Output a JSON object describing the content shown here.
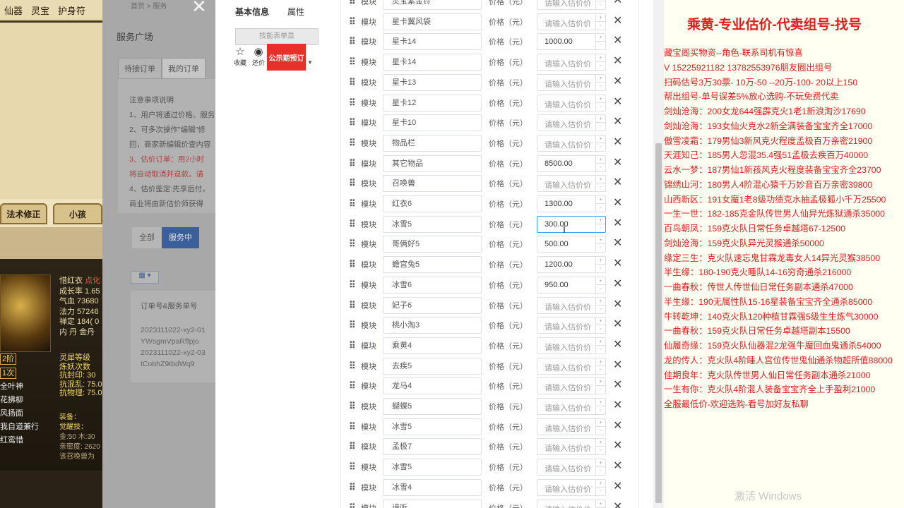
{
  "game": {
    "menu": [
      "仙器",
      "灵宝",
      "护身符"
    ],
    "tabs": [
      "法术修正",
      "小孩"
    ],
    "char_name": "惜红衣",
    "char_name_tag": "点化",
    "stats": [
      "成长率 1.65",
      "气血 73680",
      "法力 57246",
      "禅定 184( 0",
      "内 丹 金丹"
    ],
    "stats2": [
      "灵犀等级",
      "炼妖次数",
      "抗封印: 30",
      "抗混乱: 75.0",
      "抗物理: 75.0"
    ],
    "side": [
      "2阶",
      "1次",
      "全叶神",
      "花拂柳",
      "风扬面",
      "我自道兼行",
      "红鸾惜"
    ],
    "equip_label": "装备：",
    "skill_label": "觉醒技：",
    "foot": [
      "金:50 木:30",
      "亲密度: 2620",
      "该召唤兽为"
    ]
  },
  "overlay": {
    "crumb": "首页 > 服务",
    "title": "服务广场",
    "tabs": [
      "待接订单",
      "我的订单"
    ],
    "notice_title": "注意事项说明",
    "notice": [
      "1、用户将通过价格、服务",
      "2、可多次操作\"编辑\"修",
      "回，商家新编辑价查内容",
      "3、估价订单：用2小时",
      "将自动取消并退款。请",
      "4、估价鉴定:先享后付，",
      "商业将由新估价师获得"
    ],
    "filter_all": "全部",
    "filter_active": "服务中",
    "orders_header": "订单号&服务单号",
    "orders": [
      "2023111022-xy2-01",
      "YWsgmVpaRffpjo",
      "2023111022-xy2-03",
      "tCobhZ9tbdWq9"
    ]
  },
  "card": {
    "tabs": [
      "基本信息",
      "属性"
    ],
    "thumb": "技能表单显",
    "collect": "收藏",
    "bargain": "还价",
    "reserve": "公示期预订"
  },
  "form": {
    "block_label": "模块",
    "price_label": "价格（元）",
    "placeholder": "请输入估价价",
    "rows": [
      {
        "name": "灵宝紫金铃",
        "price": ""
      },
      {
        "name": "星卡翼风袋",
        "price": ""
      },
      {
        "name": "星卡14",
        "price": "1000.00"
      },
      {
        "name": "星卡14",
        "price": ""
      },
      {
        "name": "星卡13",
        "price": ""
      },
      {
        "name": "星卡12",
        "price": ""
      },
      {
        "name": "星卡10",
        "price": ""
      },
      {
        "name": "物品栏",
        "price": ""
      },
      {
        "name": "其它物品",
        "price": "8500.00"
      },
      {
        "name": "召唤兽",
        "price": ""
      },
      {
        "name": "红衣6",
        "price": "1300.00"
      },
      {
        "name": "冰雪5",
        "price": "300.00"
      },
      {
        "name": "哥俩好5",
        "price": "500.00"
      },
      {
        "name": "蟾宫兔5",
        "price": "1200.00"
      },
      {
        "name": "冰雪6",
        "price": "950.00"
      },
      {
        "name": "妃子6",
        "price": ""
      },
      {
        "name": "桃小淘3",
        "price": ""
      },
      {
        "name": "乘黄4",
        "price": ""
      },
      {
        "name": "去疾5",
        "price": ""
      },
      {
        "name": "龙马4",
        "price": ""
      },
      {
        "name": "蝴蝶5",
        "price": ""
      },
      {
        "name": "冰雪5",
        "price": ""
      },
      {
        "name": "孟极7",
        "price": ""
      },
      {
        "name": "冰雪5",
        "price": ""
      },
      {
        "name": "冰雪4",
        "price": ""
      },
      {
        "name": "谛听",
        "price": ""
      }
    ],
    "focused_index": 11
  },
  "ads": {
    "title": "乘黄-专业估价-代卖组号-找号",
    "lines": [
      "藏宝阁买物资--角色-联系司机有惊喜",
      "V 15225921182  13782553976朋友圈出组号",
      "扫码估号3万30票- 10万-50 --20万-100- 20以上150",
      "帮出组号-单号误差5%放心选购-不玩免费代卖",
      "剑灿沧海：200女龙644强霹克火1老1新浪淘沙17690",
      "剑灿沧海：193女仙火克水2新全满装备宝宝齐全17000",
      "傲雪凌霜：179男仙3新风克火程度孟极百万亲密21900",
      "天涯知己：185男人忽混35.4强51孟极去疾百万40000",
      "云水一梦：187男仙1新孩风克火程度装备宝宝齐全23700",
      "锦绣山河：180男人4阶混心猿千万妙音百万亲密39800",
      "山西新区：191女魔1老8级功绩克水抽孟极狐小千万25500",
      "一生一世：182-185克金队传世男人仙异光炼狱通杀35000",
      "百鸟朝凤：159克火队日常任务卓越塔67-12500",
      "剑灿沧海：159克火队异光灵猴通杀50000",
      "缘定三生：克火队速忘鬼甘霖龙毒女人14异光灵猴38500",
      "半生缘：180-190克火睡队14-16穷奇通杀216000",
      "一曲春秋：传世人传世仙日常任务副本通杀47000",
      "半生缘：190无属性队15-16星装备宝宝齐全通杀85000",
      "牛转乾坤：140克火队120种植甘霖强5级生生炼气30000",
      "一曲春秋：159克火队日常任务卓越塔副本15500",
      "仙履奇缘：159克火队仙器混2龙强牛魔回血鬼通杀54000",
      "龙的传人：克火队4阶睡人宫位传世鬼仙通杀物超所值88000",
      "佳期良年：克火队传世男人仙日常任务副本通杀21000",
      "一生有你：克火队4阶混人装备宝宝齐全上手盈利21000",
      "全服最低价-欢迎选购-看号加好友私聊"
    ]
  },
  "watermark": "激活 Windows"
}
